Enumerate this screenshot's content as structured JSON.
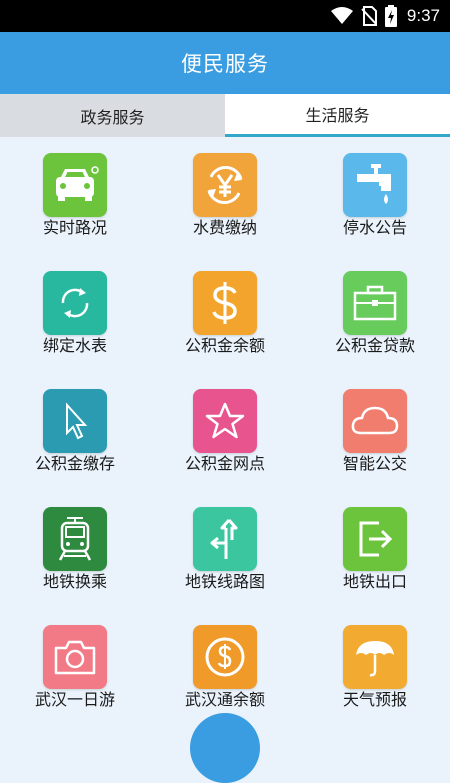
{
  "status_bar": {
    "time": "9:37"
  },
  "header": {
    "title": "便民服务"
  },
  "tabs": [
    {
      "label": "政务服务",
      "active": false
    },
    {
      "label": "生活服务",
      "active": true
    }
  ],
  "services": [
    {
      "label": "实时路况",
      "icon": "car-icon",
      "color": "#6cc43c"
    },
    {
      "label": "水费缴纳",
      "icon": "yen-refresh-icon",
      "color": "#f0a43a"
    },
    {
      "label": "停水公告",
      "icon": "water-tap-icon",
      "color": "#5ab8ea"
    },
    {
      "label": "绑定水表",
      "icon": "sync-icon",
      "color": "#27b89f"
    },
    {
      "label": "公积金余额",
      "icon": "dollar-icon",
      "color": "#f2a42c"
    },
    {
      "label": "公积金贷款",
      "icon": "briefcase-icon",
      "color": "#67cc5c"
    },
    {
      "label": "公积金缴存",
      "icon": "cursor-icon",
      "color": "#2a9bb0"
    },
    {
      "label": "公积金网点",
      "icon": "star-icon",
      "color": "#e8548e"
    },
    {
      "label": "智能公交",
      "icon": "cloud-icon",
      "color": "#f07d6e"
    },
    {
      "label": "地铁换乘",
      "icon": "train-icon",
      "color": "#2e8a3e"
    },
    {
      "label": "地铁线路图",
      "icon": "route-sign-icon",
      "color": "#3cc6a0"
    },
    {
      "label": "地铁出口",
      "icon": "exit-icon",
      "color": "#6cc43c"
    },
    {
      "label": "武汉一日游",
      "icon": "camera-icon",
      "color": "#f27a86"
    },
    {
      "label": "武汉通余额",
      "icon": "coin-icon",
      "color": "#f09a2a"
    },
    {
      "label": "天气预报",
      "icon": "umbrella-icon",
      "color": "#f2ab30"
    }
  ]
}
